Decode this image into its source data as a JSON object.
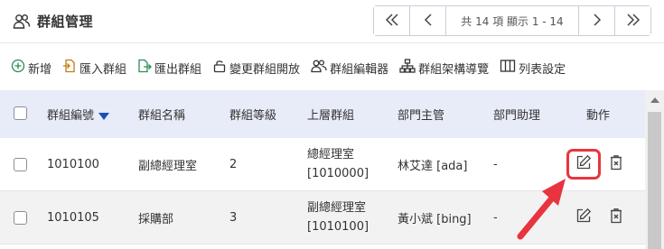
{
  "header": {
    "title": "群組管理",
    "pager": {
      "info": "共 14 項 顯示 1 - 14"
    }
  },
  "toolbar": {
    "items": [
      {
        "label": "新增",
        "icon": "plus-circle-icon"
      },
      {
        "label": "匯入群組",
        "icon": "import-file-icon"
      },
      {
        "label": "匯出群組",
        "icon": "export-file-icon"
      },
      {
        "label": "變更群組開放",
        "icon": "lock-icon"
      },
      {
        "label": "群組編輯器",
        "icon": "users-icon"
      },
      {
        "label": "群組架構導覽",
        "icon": "org-chart-icon"
      },
      {
        "label": "列表設定",
        "icon": "columns-icon"
      }
    ]
  },
  "table": {
    "columns": [
      "群組編號",
      "群組名稱",
      "群組等級",
      "上層群組",
      "部門主管",
      "部門助理",
      "動作"
    ],
    "rows": [
      {
        "id": "1010100",
        "name": "副總經理室",
        "level": "2",
        "parent_name": "總經理室",
        "parent_id": "[1010000]",
        "manager": "林艾達 [ada]",
        "assistant": "-"
      },
      {
        "id": "1010105",
        "name": "採購部",
        "level": "3",
        "parent_name": "副總經理室",
        "parent_id": "[1010100]",
        "manager": "黃小斌 [bing]",
        "assistant": "-"
      }
    ]
  },
  "colors": {
    "header_bg": "#e8ecf8",
    "accent_blue": "#1a4fb8",
    "highlight_red": "#e8343f"
  }
}
